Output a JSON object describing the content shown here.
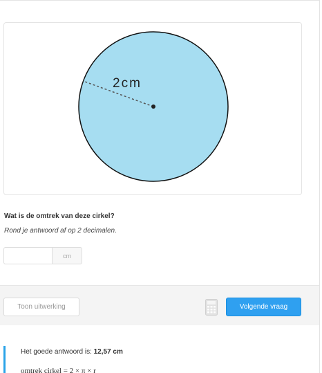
{
  "figure": {
    "radius_label": "2cm",
    "circle_fill": "#a6ddf1",
    "circle_stroke": "#111111"
  },
  "question": {
    "text": "Wat is de omtrek van deze cirkel?",
    "hint": "Rond je antwoord af op 2 decimalen."
  },
  "answer": {
    "value": "",
    "unit": "cm"
  },
  "actions": {
    "show_solution_label": "Toon uitwerking",
    "calculator_icon": "calculator-icon",
    "next_label": "Volgende vraag",
    "next_color": "#2fa0f0"
  },
  "feedback": {
    "prefix": "Het goede antwoord is: ",
    "answer": "12,57 cm",
    "formula": "omtrek cirkel = 2 × π × r",
    "accent": "#29a3e8"
  }
}
